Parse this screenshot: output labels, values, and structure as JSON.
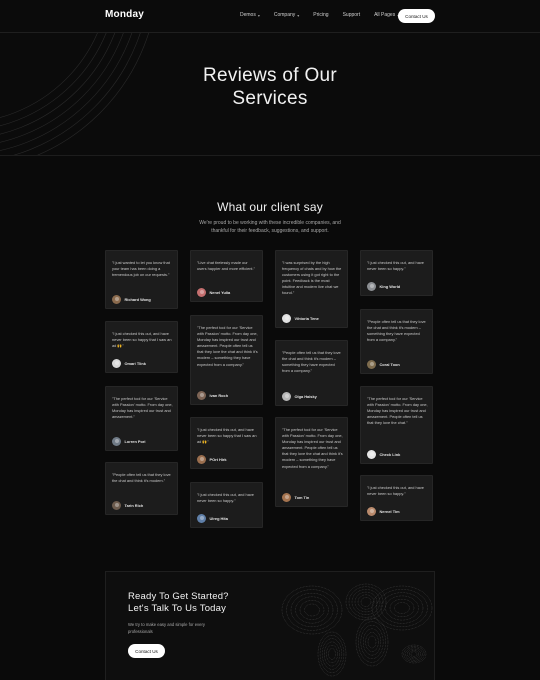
{
  "nav": {
    "brand": "Monday",
    "links": [
      {
        "label": "Demos",
        "chevron": true
      },
      {
        "label": "Company",
        "chevron": true
      },
      {
        "label": "Pricing",
        "chevron": false
      },
      {
        "label": "Support",
        "chevron": false
      },
      {
        "label": "All Pages",
        "chevron": true
      }
    ],
    "contact_label": "Contact Us"
  },
  "hero": {
    "title_line1": "Reviews of Our",
    "title_line2": "Services"
  },
  "section": {
    "title": "What our client say",
    "subtitle": "We're proud to be working with these incredible companies, and thankful for their feedback, suggestions, and support."
  },
  "reviews": {
    "columns": [
      [
        {
          "quote": "\"I just wanted to let you know that your team has been doing a tremendous job on our requests.\"",
          "name": "Richard Wong",
          "avatar_color": "#8a6a4d"
        },
        {
          "quote": "\"I just checked this out, and have never been so happy that I saw an ad 🙌\"",
          "name": "Omari Tlink",
          "avatar_color": "#d9d9d9"
        },
        {
          "quote": "\"The perfect tool for our 'Service with Passion' motto. From day one, Monday has inspired our trust and amazement.\"",
          "name": "Lorren Pori",
          "avatar_color": "#6f7a86"
        },
        {
          "quote": "\"People often tell us that they love the chat and think it's modern.\"",
          "name": "Tarin Rich",
          "avatar_color": "#6b5a4c"
        }
      ],
      [
        {
          "quote": "\"Live chat tirelessly made our users happier and more efficient.\"",
          "name": "Nenel Yulia",
          "avatar_color": "#c46f6f"
        },
        {
          "quote": "\"The perfect tool for our 'Service with Passion' motto. From day one, Monday has inspired our trust and amazement. People often tell us that they love the chat and think it's modern – something they have expected from a company.\"",
          "name": "Ivan Roch",
          "avatar_color": "#7d6455"
        },
        {
          "quote": "\"I just checked this out, and have never been so happy that I saw an ad 🙌\"",
          "name": "POrt Hirk",
          "avatar_color": "#9a6e4e"
        },
        {
          "quote": "\"I just checked this out, and have never been so happy.\"",
          "name": "Ulreg Hita",
          "avatar_color": "#5f7fa8"
        }
      ],
      [
        {
          "quote": "\"I was surprised by the high frequency of chats and by how the customers using it got right to the point. Feedback is the most intuitive and modern live chat we found.\"",
          "name": "Vihtoria Tene",
          "avatar_color": "#e2e2e2"
        },
        {
          "quote": "\"People often tell us that they love the chat and think it's modern – something they have expected from a company.\"",
          "name": "Olga Halsky",
          "avatar_color": "#b7b7b7"
        },
        {
          "quote": "\"The perfect tool for our 'Service with Passion' motto. From day one, Monday has inspired our trust and amazement. People often tell us that they love the chat and think it's modern – something they have expected from a company.\"",
          "name": "Tom Tin",
          "avatar_color": "#a5744f"
        }
      ],
      [
        {
          "quote": "\"I just checked this out, and have never been so happy.\"",
          "name": "King World",
          "avatar_color": "#8c8f93"
        },
        {
          "quote": "\"People often tell us that they love the chat and think it's modern – something they have expected from a company.\"",
          "name": "Coral Toon",
          "avatar_color": "#7e6c4e"
        },
        {
          "quote": "\"The perfect tool for our 'Service with Passion' motto. From day one, Monday has inspired our trust and amazement. People often tell us that they love the chat.\"",
          "name": "Check Link",
          "avatar_color": "#e6e6e6"
        },
        {
          "quote": "\"I just checked this out, and have never been so happy.\"",
          "name": "Nernel Tim",
          "avatar_color": "#b98a6c"
        }
      ]
    ]
  },
  "cta": {
    "title_line1": "Ready To Get Started?",
    "title_line2": "Let's Talk To Us Today",
    "subtitle": "We try to make easy and simple for every professionals",
    "button_label": "Contact Us"
  },
  "colors": {
    "background": "#0a0a0a",
    "card": "#1c1c1c",
    "accent_button": "#ffffff"
  }
}
